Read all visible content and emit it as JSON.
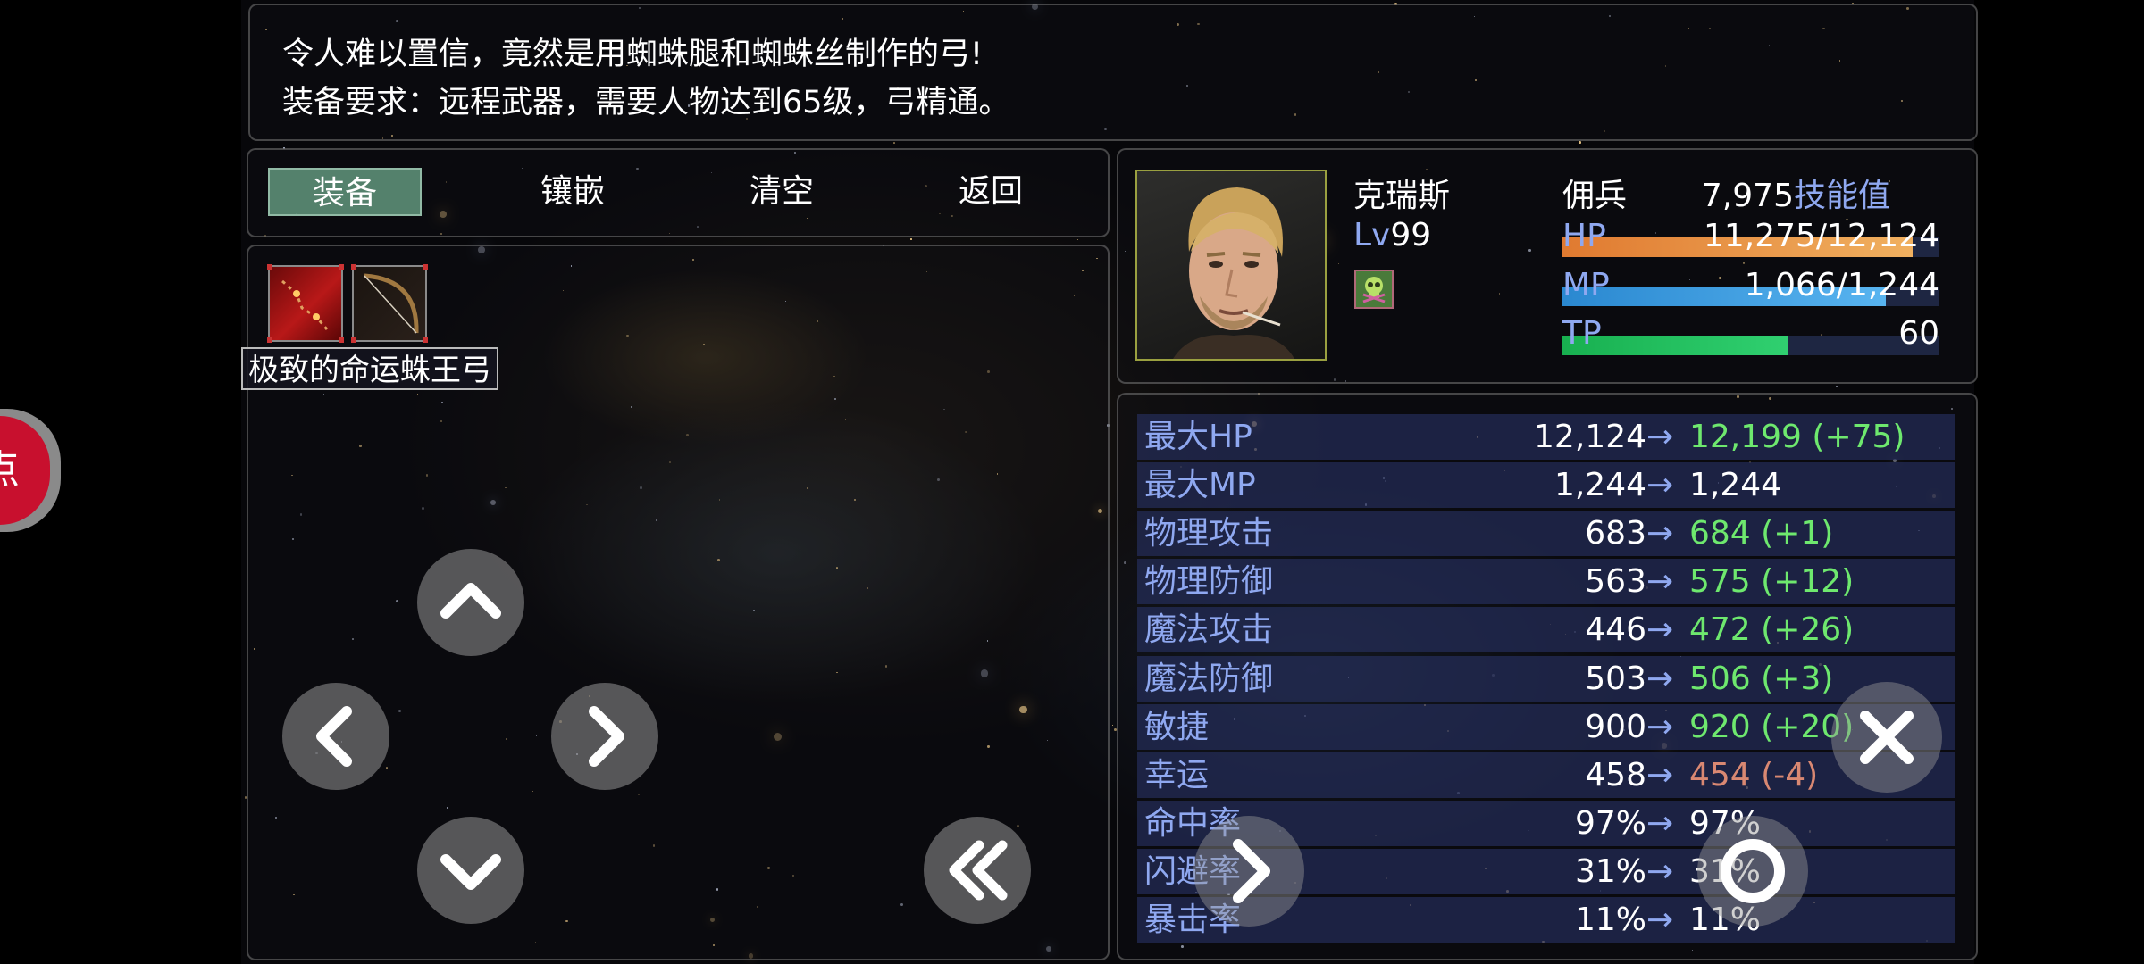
{
  "description": {
    "line1": "令人难以置信，竟然是用蜘蛛腿和蜘蛛丝制作的弓!",
    "line2": "装备要求：远程武器，需要人物达到65级，弓精通。"
  },
  "commands": [
    {
      "label": "装备",
      "selected": true
    },
    {
      "label": "镶嵌",
      "selected": false
    },
    {
      "label": "清空",
      "selected": false
    },
    {
      "label": "返回",
      "selected": false
    }
  ],
  "item": {
    "name": "极致的命运蛛王弓",
    "slot_icons": [
      "red-gem-icon",
      "bow-icon"
    ]
  },
  "actor": {
    "name": "克瑞斯",
    "class": "佣兵",
    "level_label": "Lv",
    "level": "99",
    "skill_points": "7,975",
    "skill_label": "技能值",
    "state_icon": "poison-skull-icon",
    "hp_label": "HP",
    "hp": "11,275/12,124",
    "hp_ratio": 0.93,
    "mp_label": "MP",
    "mp": "1,066/1,244",
    "mp_ratio": 0.857,
    "tp_label": "TP",
    "tp": "60",
    "tp_ratio": 0.6
  },
  "stats": [
    {
      "name": "最大HP",
      "current": "12,124",
      "arrow": "→",
      "new": "12,199 (+75)",
      "change": "up"
    },
    {
      "name": "最大MP",
      "current": "1,244",
      "arrow": "→",
      "new": "1,244",
      "change": "same"
    },
    {
      "name": "物理攻击",
      "current": "683",
      "arrow": "→",
      "new": "684 (+1)",
      "change": "up"
    },
    {
      "name": "物理防御",
      "current": "563",
      "arrow": "→",
      "new": "575 (+12)",
      "change": "up"
    },
    {
      "name": "魔法攻击",
      "current": "446",
      "arrow": "→",
      "new": "472 (+26)",
      "change": "up"
    },
    {
      "name": "魔法防御",
      "current": "503",
      "arrow": "→",
      "new": "506 (+3)",
      "change": "up"
    },
    {
      "name": "敏捷",
      "current": "900",
      "arrow": "→",
      "new": "920 (+20)",
      "change": "up"
    },
    {
      "name": "幸运",
      "current": "458",
      "arrow": "→",
      "new": "454 (-4)",
      "change": "down"
    },
    {
      "name": "命中率",
      "current": "97%",
      "arrow": "→",
      "new": "97%",
      "change": "same"
    },
    {
      "name": "闪避率",
      "current": "31%",
      "arrow": "→",
      "new": "31%",
      "change": "same"
    },
    {
      "name": "暴击率",
      "current": "11%",
      "arrow": "→",
      "new": "11%",
      "change": "same"
    }
  ],
  "side_tab": {
    "label": "点"
  },
  "colors": {
    "hp": "#e8913a",
    "mp": "#3a9ee0",
    "tp": "#20c55a",
    "stat_up": "#6ee86e",
    "stat_down": "#d98872",
    "system_blue": "#8fa8f0",
    "selected_command": "#6eaa8c",
    "side_tab": "#c8102e"
  }
}
